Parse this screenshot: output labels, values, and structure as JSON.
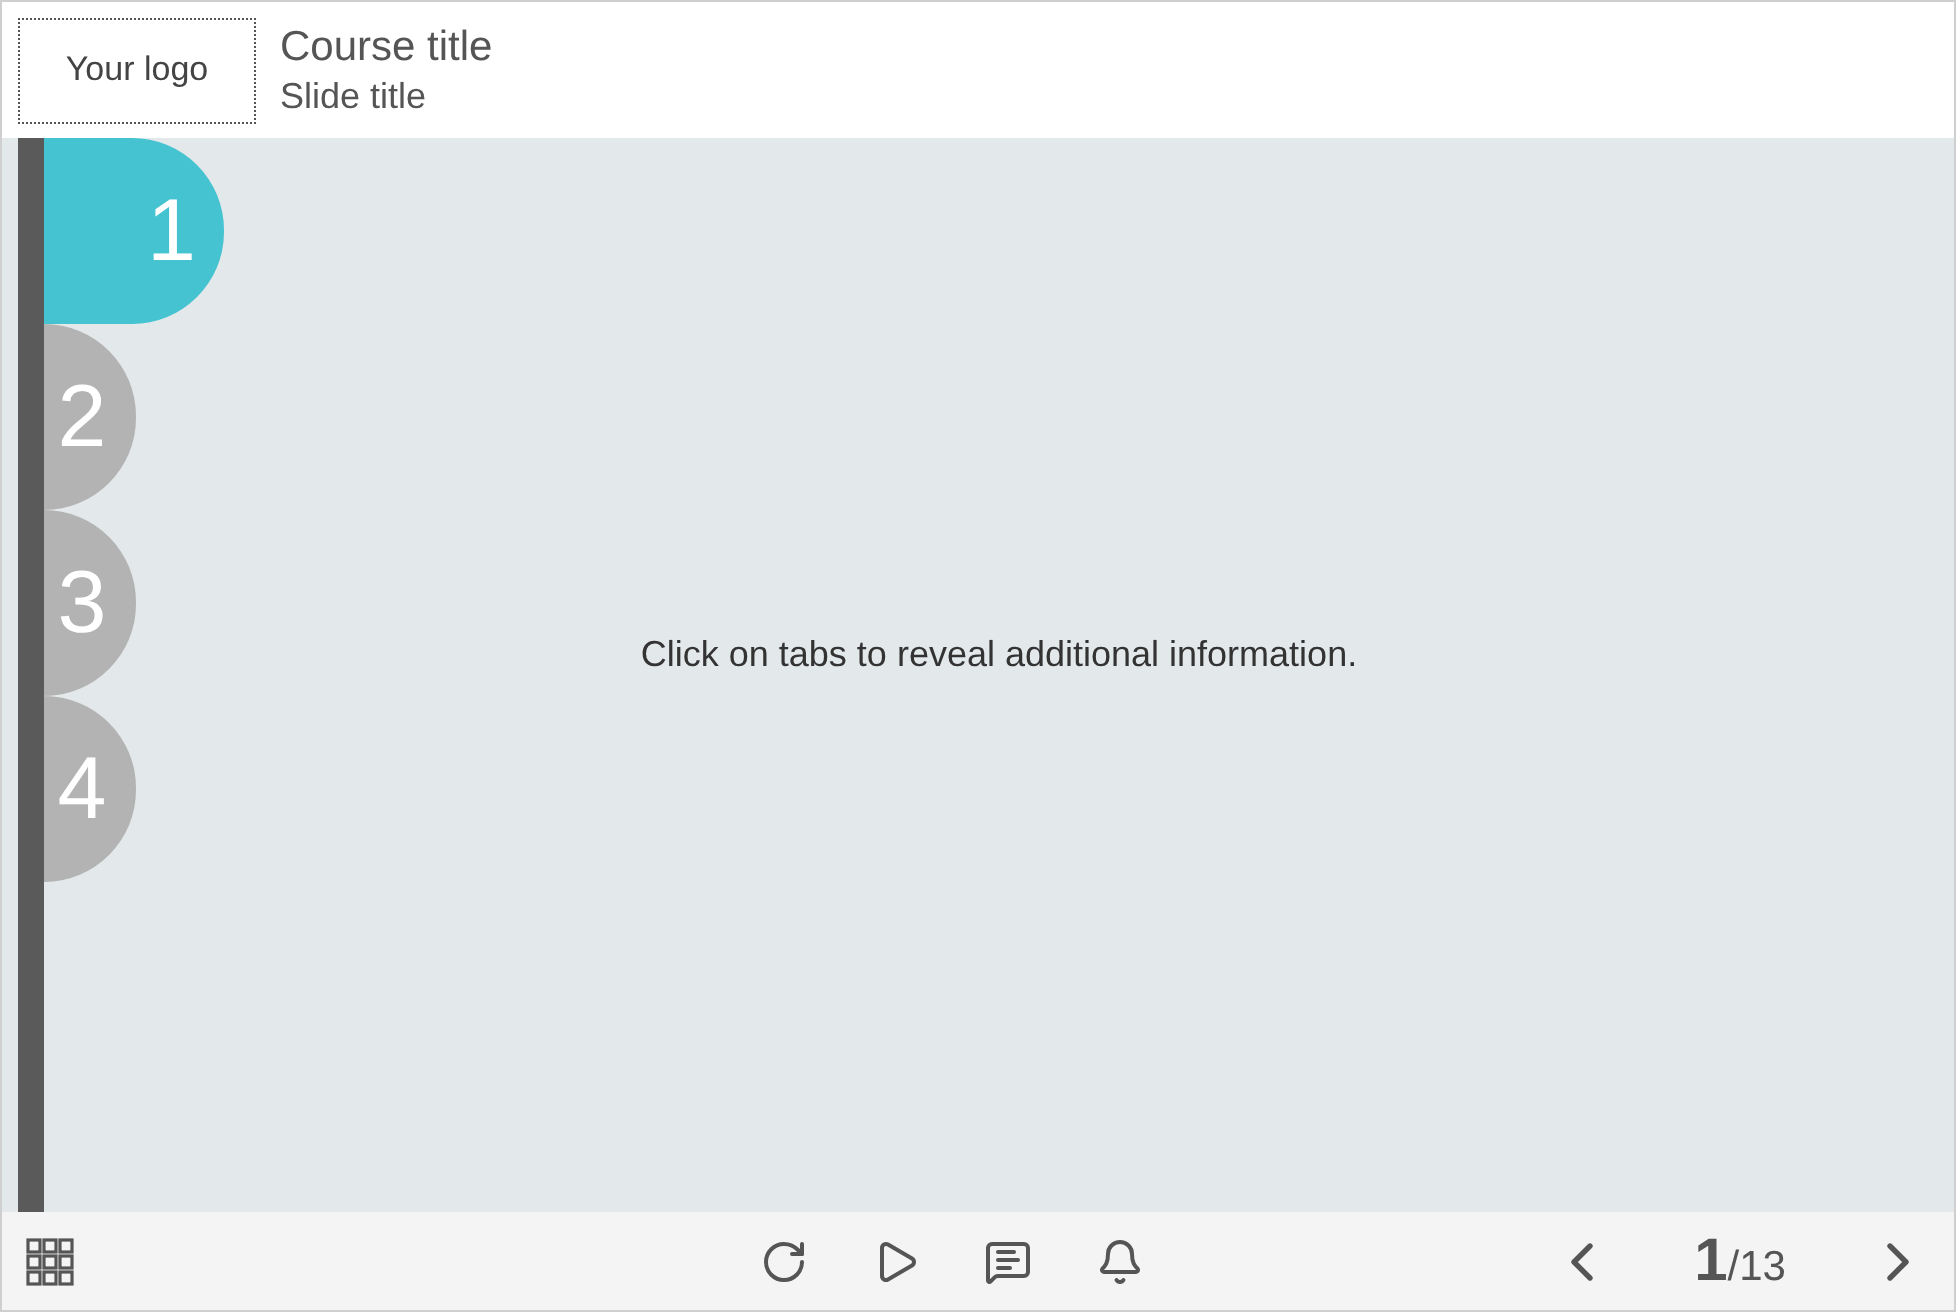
{
  "header": {
    "logo": "Your logo",
    "course_title": "Course title",
    "slide_title": "Slide title"
  },
  "tabs": [
    {
      "label": "1",
      "selected": true
    },
    {
      "label": "2",
      "selected": false
    },
    {
      "label": "3",
      "selected": false
    },
    {
      "label": "4",
      "selected": false
    }
  ],
  "content": {
    "text": "Click on tabs to reveal additional information."
  },
  "footer": {
    "current_slide": "1",
    "total_slides": "/13"
  }
}
